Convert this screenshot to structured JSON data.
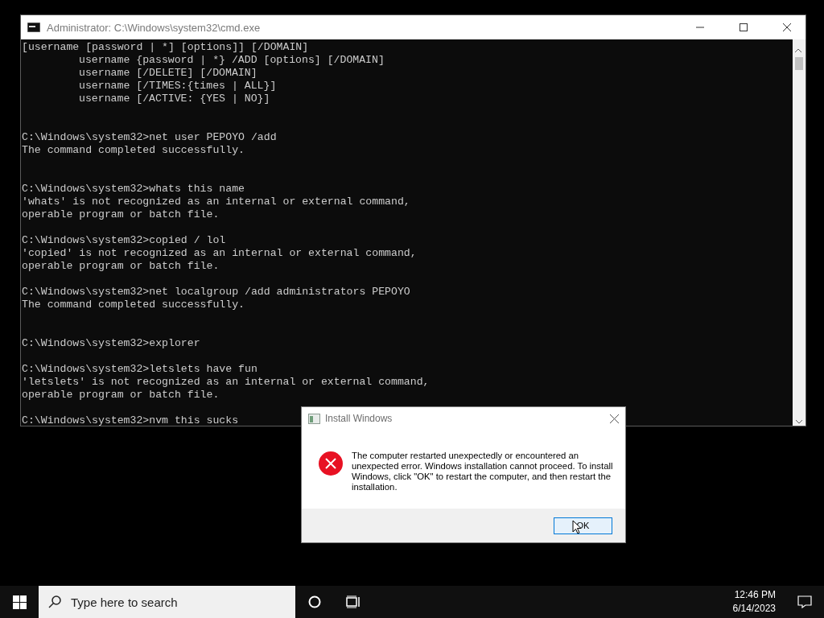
{
  "console_window": {
    "title": "Administrator: C:\\Windows\\system32\\cmd.exe",
    "blocks": [
      {
        "kind": "spaced",
        "lines": [
          "[username [password | *] [options]] [/DOMAIN]"
        ],
        "indented_lines": [
          "username {password | *} /ADD [options] [/DOMAIN]",
          "username [/DELETE] [/DOMAIN]",
          "username [/TIMES:{times | ALL}]",
          "username [/ACTIVE: {YES | NO}]"
        ]
      },
      {
        "kind": "spaced",
        "lines": [
          "C:\\Windows\\system32>net user PEPOYO /add",
          "The command completed successfully."
        ]
      },
      {
        "kind": "single",
        "lines": [
          "C:\\Windows\\system32>whats this name",
          "'whats' is not recognized as an internal or external command,",
          "operable program or batch file."
        ]
      },
      {
        "kind": "single",
        "lines": [
          "C:\\Windows\\system32>copied / lol",
          "'copied' is not recognized as an internal or external command,",
          "operable program or batch file."
        ]
      },
      {
        "kind": "spaced",
        "lines": [
          "C:\\Windows\\system32>net localgroup /add administrators PEPOYO",
          "The command completed successfully."
        ]
      },
      {
        "kind": "single",
        "lines": [
          "C:\\Windows\\system32>explorer"
        ]
      },
      {
        "kind": "single",
        "lines": [
          "C:\\Windows\\system32>letslets have fun",
          "'letslets' is not recognized as an internal or external command,",
          "operable program or batch file."
        ]
      },
      {
        "kind": "single",
        "lines": [
          "C:\\Windows\\system32>nvm this sucks"
        ]
      }
    ]
  },
  "dialog": {
    "title": "Install Windows",
    "message": "The computer restarted unexpectedly or encountered an unexpected error. Windows installation cannot proceed. To install Windows, click \"OK\" to restart the computer, and then restart the installation.",
    "button": "OK"
  },
  "taskbar": {
    "search": {
      "placeholder": "Type here to search"
    },
    "time": "12:46 PM",
    "date": "6/14/2023"
  }
}
